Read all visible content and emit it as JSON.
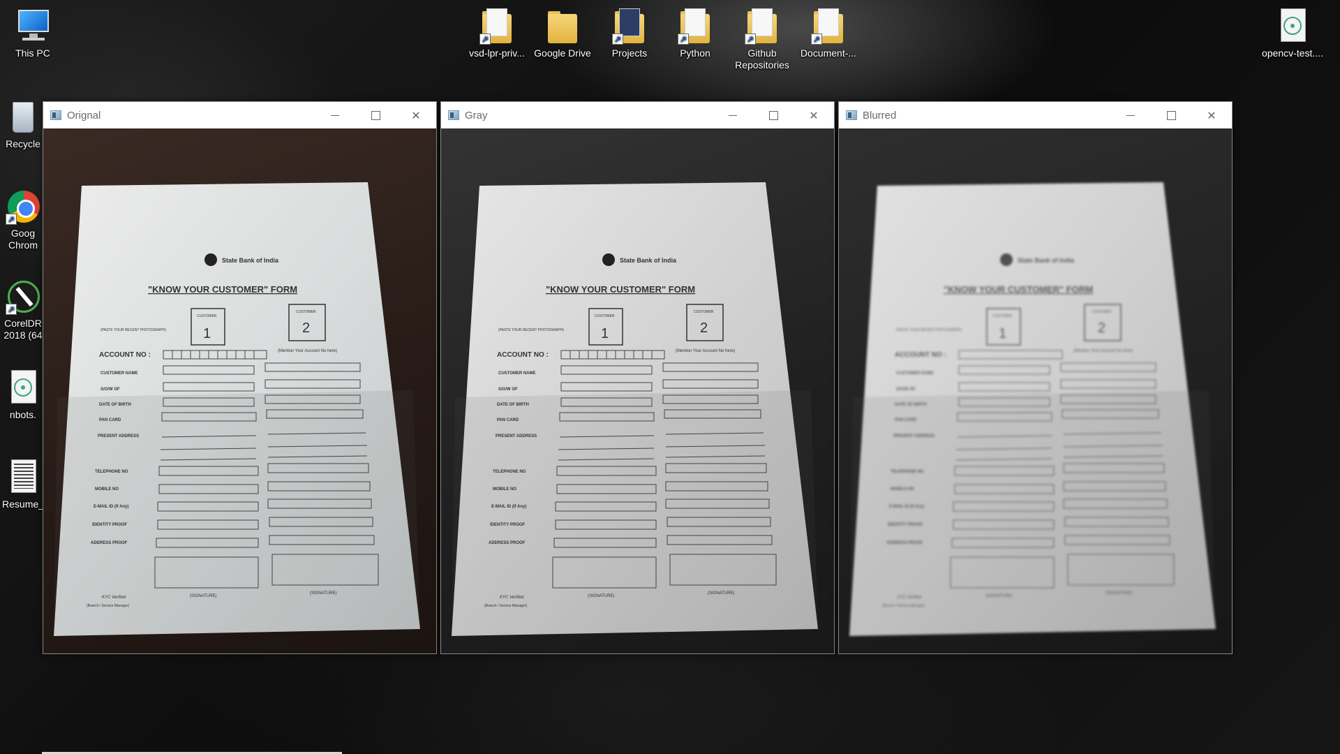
{
  "desktop": {
    "left_icons": [
      {
        "label": "This PC",
        "icon": "this-pc-icon"
      },
      {
        "label": "Recycle",
        "icon": "recycle-bin-icon"
      },
      {
        "label": "Goog Chrom",
        "icon": "chrome-icon"
      },
      {
        "label": "CorelDR 2018 (64",
        "icon": "coreldraw-icon"
      },
      {
        "label": "nbots.",
        "icon": "atom-file-icon"
      },
      {
        "label": "Resume_",
        "icon": "resume-document-icon"
      }
    ],
    "top_icons": [
      {
        "label": "vsd-lpr-priv...",
        "icon": "folder-shortcut-icon"
      },
      {
        "label": "Google Drive",
        "icon": "folder-icon"
      },
      {
        "label": "Projects",
        "icon": "folder-shortcut-icon"
      },
      {
        "label": "Python",
        "icon": "folder-shortcut-icon"
      },
      {
        "label": "Github Repositories",
        "icon": "folder-shortcut-icon"
      },
      {
        "label": "Document-...",
        "icon": "folder-shortcut-icon"
      }
    ],
    "right_icon": {
      "label": "opencv-test....",
      "icon": "atom-file-icon"
    }
  },
  "windows": [
    {
      "title": "Orignal",
      "variant": "original"
    },
    {
      "title": "Gray",
      "variant": "gray"
    },
    {
      "title": "Blurred",
      "variant": "blurred"
    }
  ],
  "document": {
    "bank": "State Bank of India",
    "form_title": "\"KNOW YOUR CUSTOMER\" FORM",
    "photo_hint": "(PASTE YOUR RECENT PHOTOGRAPH)",
    "customer_label": "CUSTOMER",
    "customer_1": "1",
    "customer_2": "2",
    "account_no": "ACCOUNT NO :",
    "account_hint": "(Mention Your Account No here)",
    "fields": [
      "CUSTOMER NAME",
      "S/O/W OF",
      "DATE OF BIRTH",
      "PAN CARD",
      "PRESENT ADDRESS",
      "TELEPHONE NO",
      "MOBILE NO",
      "E-MAIL ID (If Any)",
      "IDENTITY PROOF",
      "ADDRESS PROOF"
    ],
    "signature": "(SIGNATURE)",
    "kyc": "KYC Verified",
    "kyc_sub": "(Branch / Service Manager)"
  }
}
